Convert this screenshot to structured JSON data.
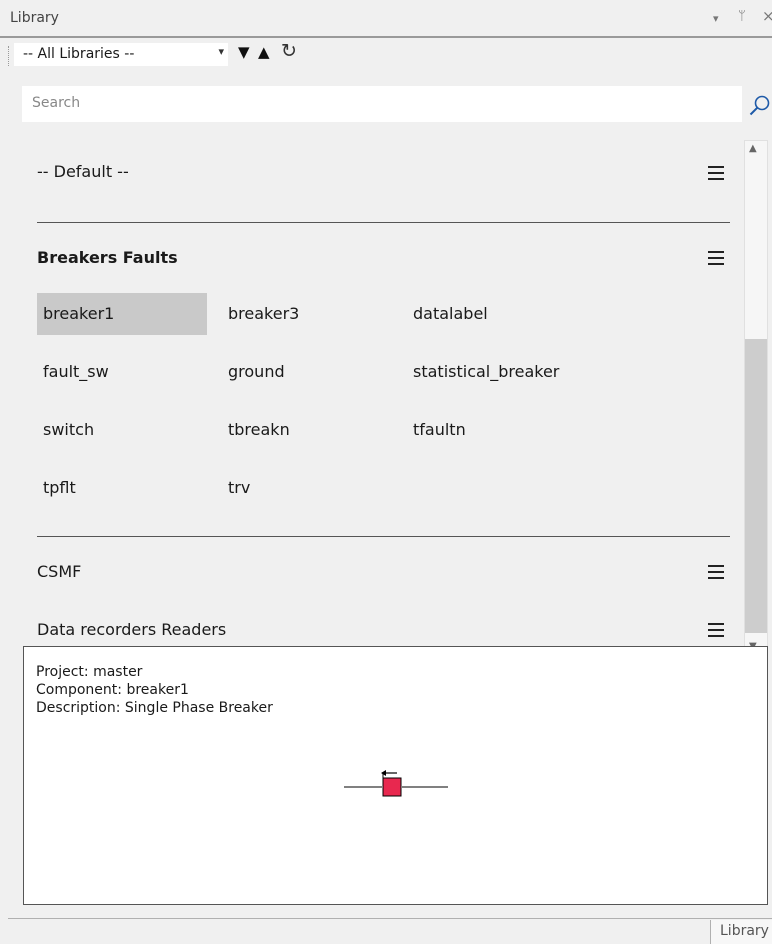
{
  "window": {
    "title": "Library",
    "controls": {
      "dropdown": "▾",
      "pin": "ᛘ",
      "close": "×"
    }
  },
  "toolbar": {
    "library_select": {
      "value": "-- All Libraries --",
      "arrow": "▾"
    },
    "move_down": "▼",
    "move_up": "▲",
    "refresh": "↻"
  },
  "search": {
    "placeholder": "Search",
    "value": ""
  },
  "groups": [
    {
      "title": "-- Default --",
      "bold": false
    },
    {
      "title": "Breakers Faults",
      "bold": true,
      "items": [
        [
          "breaker1",
          "breaker3",
          "datalabel"
        ],
        [
          "fault_sw",
          "ground",
          "statistical_breaker"
        ],
        [
          "switch",
          "tbreakn",
          "tfaultn"
        ],
        [
          "tpflt",
          "trv"
        ]
      ],
      "selected": "breaker1"
    },
    {
      "title": "CSMF",
      "bold": false
    },
    {
      "title": "Data recorders Readers",
      "bold": false
    }
  ],
  "scrollbar": {
    "position_fraction": 0.43
  },
  "preview": {
    "project": "Project: master",
    "component": "Component: breaker1",
    "description": "Description: Single Phase Breaker",
    "colors": {
      "breaker_fill": "#e8284f",
      "line": "#000000"
    }
  },
  "bottom_tab": {
    "label": "Library"
  }
}
